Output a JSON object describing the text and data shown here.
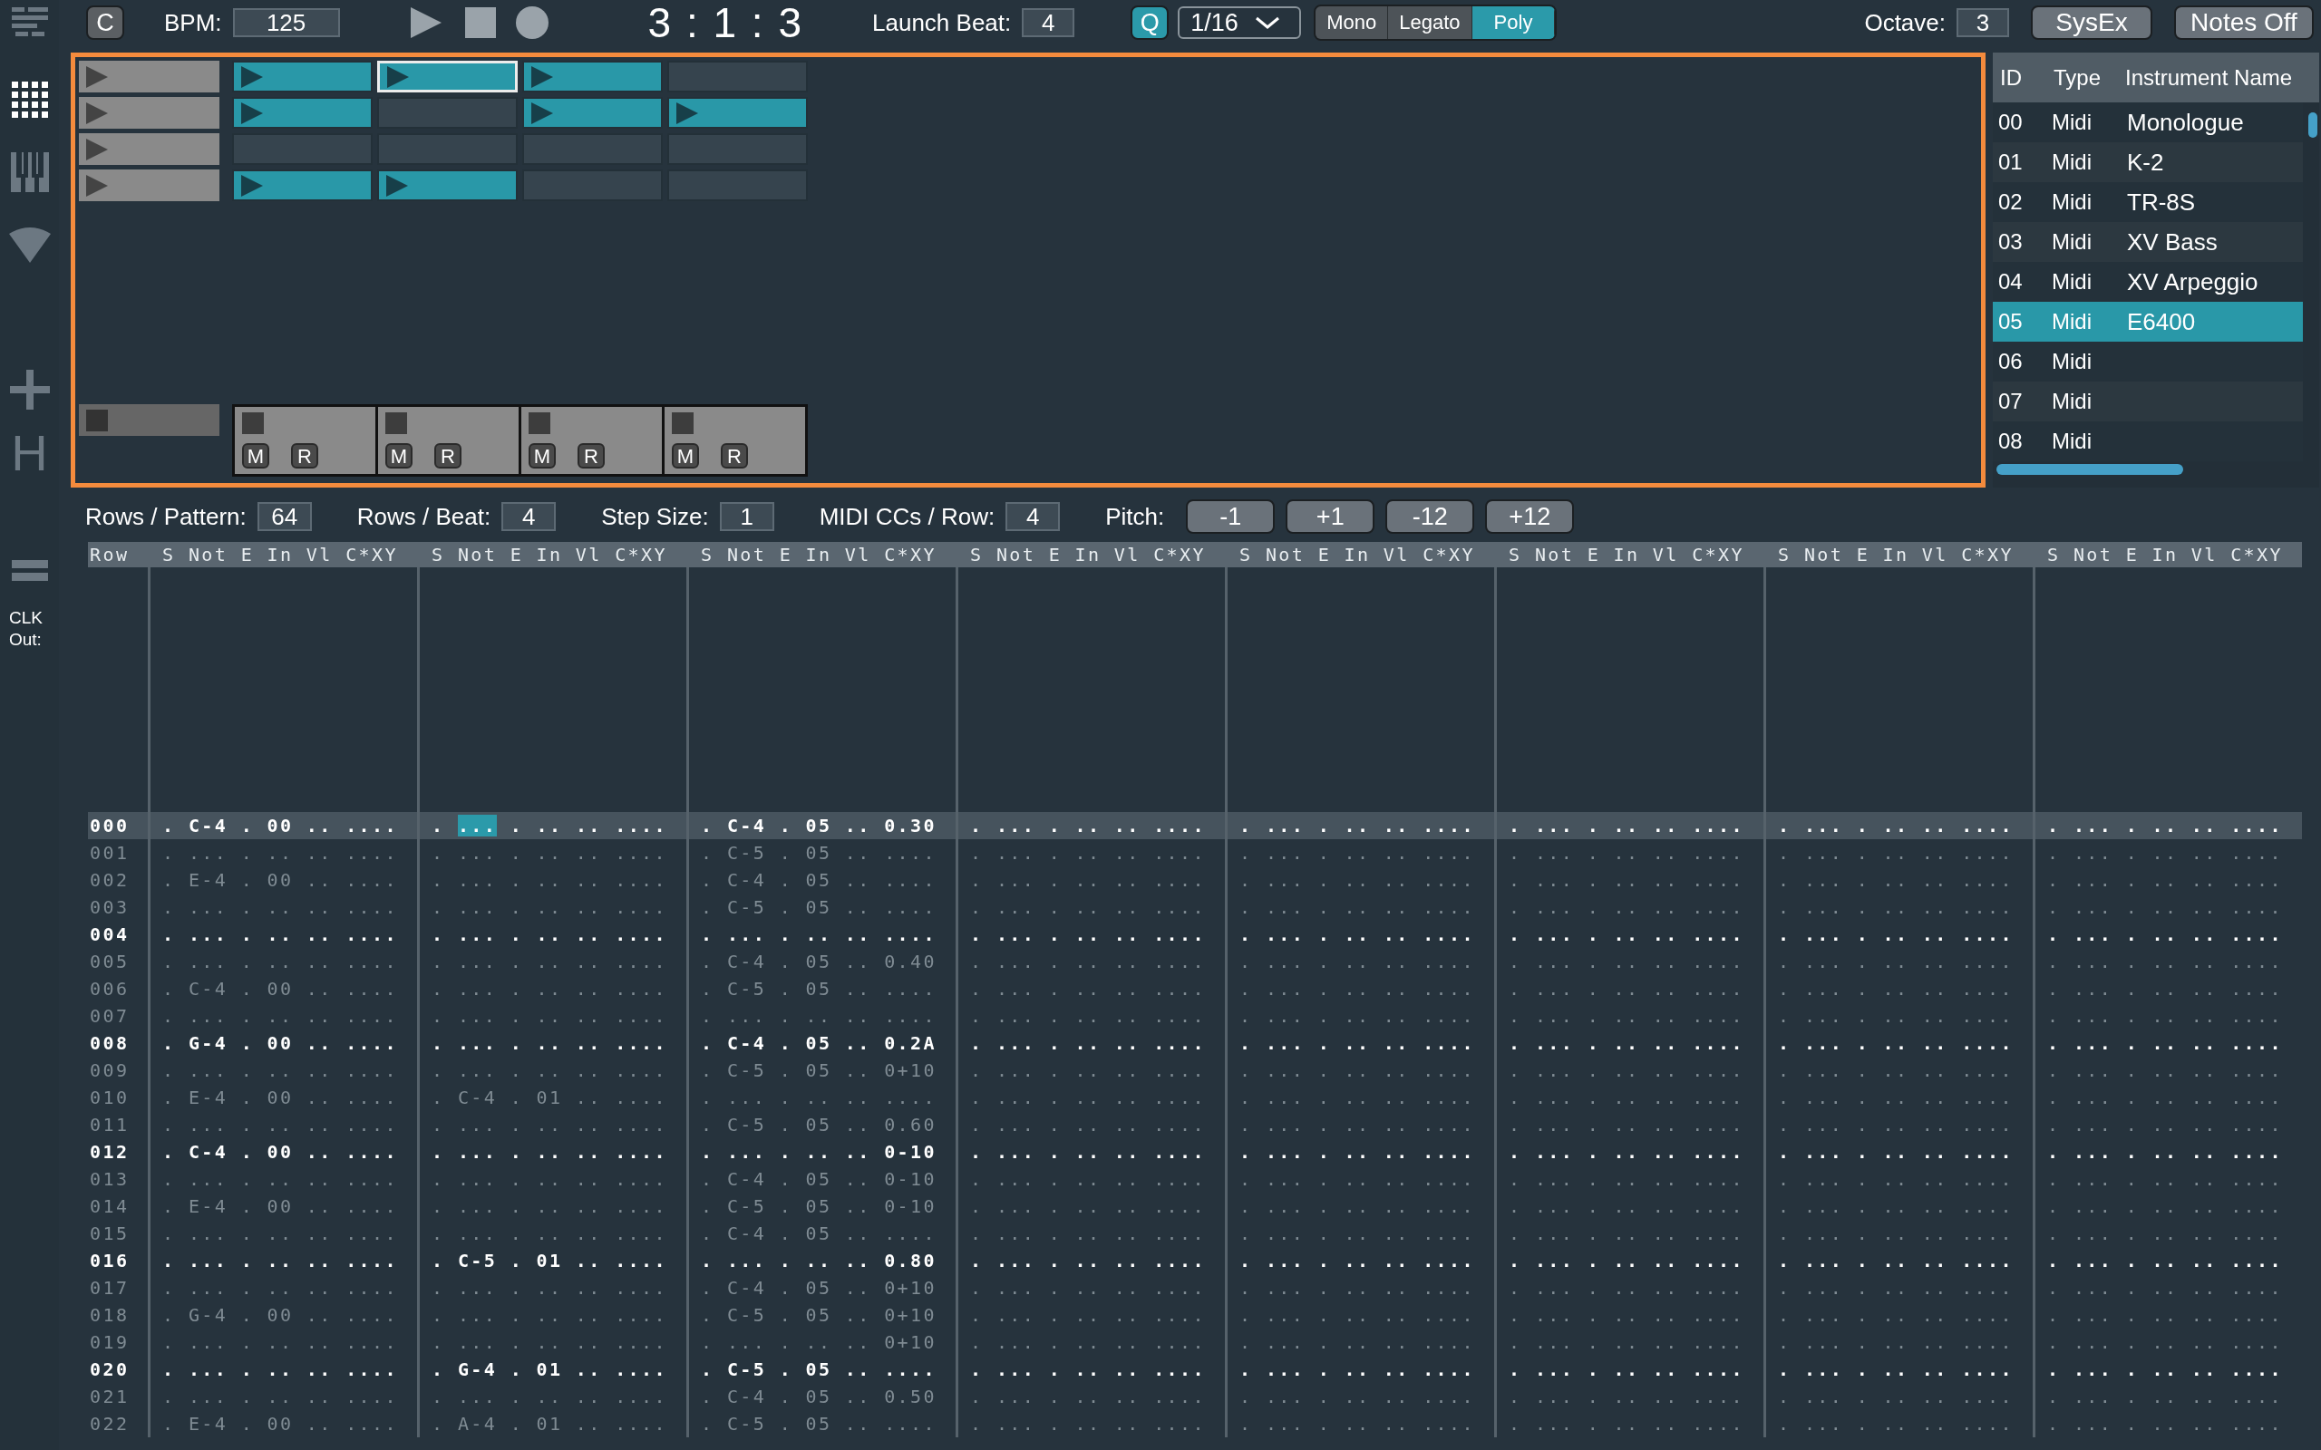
{
  "sidebar": {
    "items": [
      {
        "kind": "list",
        "selected": false
      },
      {
        "kind": "grid",
        "selected": true
      },
      {
        "kind": "piano",
        "selected": false
      },
      {
        "kind": "cone",
        "selected": false
      },
      {
        "kind": "add",
        "selected": false
      },
      {
        "kind": "letter",
        "label": "H",
        "selected": false
      },
      {
        "kind": "bars",
        "selected": false
      }
    ],
    "clock_label": "CLK Out:"
  },
  "transport": {
    "clear_button": "C",
    "bpm_label": "BPM:",
    "bpm": "125",
    "position": "3 : 1 : 3",
    "launch_beat_label": "Launch Beat:",
    "launch_beat": "4",
    "quantize_button": {
      "label": "Q",
      "on": true
    },
    "quantize_value": "1/16",
    "modes": [
      {
        "label": "Mono",
        "selected": false
      },
      {
        "label": "Legato",
        "selected": false
      },
      {
        "label": "Poly",
        "selected": true
      }
    ],
    "octave_label": "Octave:",
    "octave": "3",
    "sysex_button": "SysEx",
    "notes_off_button": "Notes Off"
  },
  "session": {
    "scenes": [
      {
        "clips": [
          {
            "filled": true,
            "selected": false
          },
          {
            "filled": true,
            "selected": true
          },
          {
            "filled": true,
            "selected": false
          },
          {
            "filled": false,
            "selected": false
          }
        ]
      },
      {
        "clips": [
          {
            "filled": true,
            "selected": false
          },
          {
            "filled": false,
            "selected": false
          },
          {
            "filled": true,
            "selected": false
          },
          {
            "filled": true,
            "selected": false
          }
        ]
      },
      {
        "clips": [
          {
            "filled": false,
            "selected": false
          },
          {
            "filled": false,
            "selected": false
          },
          {
            "filled": false,
            "selected": false
          },
          {
            "filled": false,
            "selected": false
          }
        ]
      },
      {
        "clips": [
          {
            "filled": true,
            "selected": false
          },
          {
            "filled": true,
            "selected": false
          },
          {
            "filled": false,
            "selected": false
          },
          {
            "filled": false,
            "selected": false
          }
        ]
      }
    ],
    "track_footers": [
      {
        "mute_label": "M",
        "record_label": "R"
      },
      {
        "mute_label": "M",
        "record_label": "R"
      },
      {
        "mute_label": "M",
        "record_label": "R"
      },
      {
        "mute_label": "M",
        "record_label": "R"
      }
    ]
  },
  "instruments": {
    "columns": [
      "ID",
      "Type",
      "Instrument Name"
    ],
    "rows": [
      {
        "id": "00",
        "type": "Midi",
        "name": "Monologue",
        "selected": false
      },
      {
        "id": "01",
        "type": "Midi",
        "name": "K-2",
        "selected": false
      },
      {
        "id": "02",
        "type": "Midi",
        "name": "TR-8S",
        "selected": false
      },
      {
        "id": "03",
        "type": "Midi",
        "name": "XV Bass",
        "selected": false
      },
      {
        "id": "04",
        "type": "Midi",
        "name": "XV Arpeggio",
        "selected": false
      },
      {
        "id": "05",
        "type": "Midi",
        "name": "E6400",
        "selected": true
      },
      {
        "id": "06",
        "type": "Midi",
        "selected": false
      },
      {
        "id": "07",
        "type": "Midi",
        "selected": false
      },
      {
        "id": "08",
        "type": "Midi",
        "selected": false
      }
    ]
  },
  "pattern_settings": [
    {
      "label": "Rows / Pattern:",
      "value": "64"
    },
    {
      "label": "Rows / Beat:",
      "value": "4"
    },
    {
      "label": "Step Size:",
      "value": "1"
    },
    {
      "label": "MIDI CCs / Row:",
      "value": "4"
    }
  ],
  "pitch": {
    "label": "Pitch:",
    "buttons": [
      "-1",
      "+1",
      "-12",
      "+12"
    ]
  },
  "tracker": {
    "row_header": "Row",
    "track_headers": [
      "S Not E In Vl C*XY",
      "S Not E In Vl C*XY",
      "S Not E In Vl C*XY",
      "S Not E In Vl C*XY",
      "S Not E In Vl C*XY",
      "S Not E In Vl C*XY",
      "S Not E In Vl C*XY",
      "S Not E In Vl C*XY"
    ],
    "rows": [
      {
        "number": "000",
        "beat": true,
        "selected": true,
        "tracks": [
          ". C-4 . 00 .. ....",
          {
            "kind": "cursor",
            "before": ".",
            "cursor": "...",
            "after": ". .. .. ...."
          },
          ". C-4 . 05 .. 0.30",
          ". ... . .. .. ....",
          ". ... . .. .. ....",
          ". ... . .. .. ....",
          ". ... . .. .. ....",
          ". ... . .. .. ...."
        ]
      },
      {
        "number": "001",
        "beat": false,
        "selected": false,
        "tracks": [
          ". ... . .. .. ....",
          ". ... . .. .. ....",
          ". C-5 . 05 .. ....",
          ". ... . .. .. ....",
          ". ... . .. .. ....",
          ". ... . .. .. ....",
          ". ... . .. .. ....",
          ". ... . .. .. ...."
        ]
      },
      {
        "number": "002",
        "beat": false,
        "selected": false,
        "tracks": [
          ". E-4 . 00 .. ....",
          ". ... . .. .. ....",
          ". C-4 . 05 .. ....",
          ". ... . .. .. ....",
          ". ... . .. .. ....",
          ". ... . .. .. ....",
          ". ... . .. .. ....",
          ". ... . .. .. ...."
        ]
      },
      {
        "number": "003",
        "beat": false,
        "selected": false,
        "tracks": [
          ". ... . .. .. ....",
          ". ... . .. .. ....",
          ". C-5 . 05 .. ....",
          ". ... . .. .. ....",
          ". ... . .. .. ....",
          ". ... . .. .. ....",
          ". ... . .. .. ....",
          ". ... . .. .. ...."
        ]
      },
      {
        "number": "004",
        "beat": true,
        "selected": false,
        "tracks": [
          ". ... . .. .. ....",
          ". ... . .. .. ....",
          ". ... . .. .. ....",
          ". ... . .. .. ....",
          ". ... . .. .. ....",
          ". ... . .. .. ....",
          ". ... . .. .. ....",
          ". ... . .. .. ...."
        ]
      },
      {
        "number": "005",
        "beat": false,
        "selected": false,
        "tracks": [
          ". ... . .. .. ....",
          ". ... . .. .. ....",
          ". C-4 . 05 .. 0.40",
          ". ... . .. .. ....",
          ". ... . .. .. ....",
          ". ... . .. .. ....",
          ". ... . .. .. ....",
          ". ... . .. .. ...."
        ]
      },
      {
        "number": "006",
        "beat": false,
        "selected": false,
        "tracks": [
          ". C-4 . 00 .. ....",
          ". ... . .. .. ....",
          ". C-5 . 05 .. ....",
          ". ... . .. .. ....",
          ". ... . .. .. ....",
          ". ... . .. .. ....",
          ". ... . .. .. ....",
          ". ... . .. .. ...."
        ]
      },
      {
        "number": "007",
        "beat": false,
        "selected": false,
        "tracks": [
          ". ... . .. .. ....",
          ". ... . .. .. ....",
          ". ... . .. .. ....",
          ". ... . .. .. ....",
          ". ... . .. .. ....",
          ". ... . .. .. ....",
          ". ... . .. .. ....",
          ". ... . .. .. ...."
        ]
      },
      {
        "number": "008",
        "beat": true,
        "selected": false,
        "tracks": [
          ". G-4 . 00 .. ....",
          ". ... . .. .. ....",
          ". C-4 . 05 .. 0.2A",
          ". ... . .. .. ....",
          ". ... . .. .. ....",
          ". ... . .. .. ....",
          ". ... . .. .. ....",
          ". ... . .. .. ...."
        ]
      },
      {
        "number": "009",
        "beat": false,
        "selected": false,
        "tracks": [
          ". ... . .. .. ....",
          ". ... . .. .. ....",
          ". C-5 . 05 .. 0+10",
          ". ... . .. .. ....",
          ". ... . .. .. ....",
          ". ... . .. .. ....",
          ". ... . .. .. ....",
          ". ... . .. .. ...."
        ]
      },
      {
        "number": "010",
        "beat": false,
        "selected": false,
        "tracks": [
          ". E-4 . 00 .. ....",
          ". C-4 . 01 .. ....",
          ". ... . .. .. ....",
          ". ... . .. .. ....",
          ". ... . .. .. ....",
          ". ... . .. .. ....",
          ". ... . .. .. ....",
          ". ... . .. .. ...."
        ]
      },
      {
        "number": "011",
        "beat": false,
        "selected": false,
        "tracks": [
          ". ... . .. .. ....",
          ". ... . .. .. ....",
          ". C-5 . 05 .. 0.60",
          ". ... . .. .. ....",
          ". ... . .. .. ....",
          ". ... . .. .. ....",
          ". ... . .. .. ....",
          ". ... . .. .. ...."
        ]
      },
      {
        "number": "012",
        "beat": true,
        "selected": false,
        "tracks": [
          ". C-4 . 00 .. ....",
          ". ... . .. .. ....",
          ". ... . .. .. 0-10",
          ". ... . .. .. ....",
          ". ... . .. .. ....",
          ". ... . .. .. ....",
          ". ... . .. .. ....",
          ". ... . .. .. ...."
        ]
      },
      {
        "number": "013",
        "beat": false,
        "selected": false,
        "tracks": [
          ". ... . .. .. ....",
          ". ... . .. .. ....",
          ". C-4 . 05 .. 0-10",
          ". ... . .. .. ....",
          ". ... . .. .. ....",
          ". ... . .. .. ....",
          ". ... . .. .. ....",
          ". ... . .. .. ...."
        ]
      },
      {
        "number": "014",
        "beat": false,
        "selected": false,
        "tracks": [
          ". E-4 . 00 .. ....",
          ". ... . .. .. ....",
          ". C-5 . 05 .. 0-10",
          ". ... . .. .. ....",
          ". ... . .. .. ....",
          ". ... . .. .. ....",
          ". ... . .. .. ....",
          ". ... . .. .. ...."
        ]
      },
      {
        "number": "015",
        "beat": false,
        "selected": false,
        "tracks": [
          ". ... . .. .. ....",
          ". ... . .. .. ....",
          ". C-4 . 05 .. ....",
          ". ... . .. .. ....",
          ". ... . .. .. ....",
          ". ... . .. .. ....",
          ". ... . .. .. ....",
          ". ... . .. .. ...."
        ]
      },
      {
        "number": "016",
        "beat": true,
        "selected": false,
        "tracks": [
          ". ... . .. .. ....",
          ". C-5 . 01 .. ....",
          ". ... . .. .. 0.80",
          ". ... . .. .. ....",
          ". ... . .. .. ....",
          ". ... . .. .. ....",
          ". ... . .. .. ....",
          ". ... . .. .. ...."
        ]
      },
      {
        "number": "017",
        "beat": false,
        "selected": false,
        "tracks": [
          ". ... . .. .. ....",
          ". ... . .. .. ....",
          ". C-4 . 05 .. 0+10",
          ". ... . .. .. ....",
          ". ... . .. .. ....",
          ". ... . .. .. ....",
          ". ... . .. .. ....",
          ". ... . .. .. ...."
        ]
      },
      {
        "number": "018",
        "beat": false,
        "selected": false,
        "tracks": [
          ". G-4 . 00 .. ....",
          ". ... . .. .. ....",
          ". C-5 . 05 .. 0+10",
          ". ... . .. .. ....",
          ". ... . .. .. ....",
          ". ... . .. .. ....",
          ". ... . .. .. ....",
          ". ... . .. .. ...."
        ]
      },
      {
        "number": "019",
        "beat": false,
        "selected": false,
        "tracks": [
          ". ... . .. .. ....",
          ". ... . .. .. ....",
          ". ... . .. .. 0+10",
          ". ... . .. .. ....",
          ". ... . .. .. ....",
          ". ... . .. .. ....",
          ". ... . .. .. ....",
          ". ... . .. .. ...."
        ]
      },
      {
        "number": "020",
        "beat": true,
        "selected": false,
        "tracks": [
          ". ... . .. .. ....",
          ". G-4 . 01 .. ....",
          ". C-5 . 05 .. ....",
          ". ... . .. .. ....",
          ". ... . .. .. ....",
          ". ... . .. .. ....",
          ". ... . .. .. ....",
          ". ... . .. .. ...."
        ]
      },
      {
        "number": "021",
        "beat": false,
        "selected": false,
        "tracks": [
          ". ... . .. .. ....",
          ". ... . .. .. ....",
          ". C-4 . 05 .. 0.50",
          ". ... . .. .. ....",
          ". ... . .. .. ....",
          ". ... . .. .. ....",
          ". ... . .. .. ....",
          ". ... . .. .. ...."
        ]
      },
      {
        "number": "022",
        "beat": false,
        "selected": false,
        "tracks": [
          ". E-4 . 00 .. ....",
          ". A-4 . 01 .. ....",
          ". C-5 . 05 .. ....",
          ". ... . .. .. ....",
          ". ... . .. .. ....",
          ". ... . .. .. ....",
          ". ... . .. .. ....",
          ". ... . .. .. ...."
        ]
      }
    ]
  }
}
